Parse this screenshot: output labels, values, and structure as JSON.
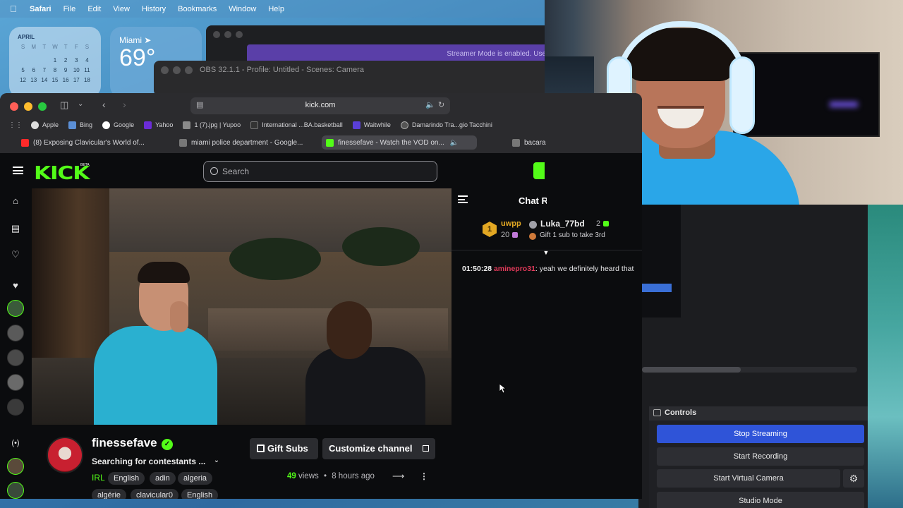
{
  "menubar": {
    "app": "Safari",
    "items": [
      "File",
      "Edit",
      "View",
      "History",
      "Bookmarks",
      "Window",
      "Help"
    ]
  },
  "calendar": {
    "month": "APRIL",
    "weekdays": [
      "S",
      "M",
      "T",
      "W",
      "T",
      "F",
      "S"
    ],
    "days": [
      "",
      "",
      "",
      "",
      "",
      "",
      "",
      "",
      "",
      "",
      "1",
      "2",
      "3",
      "4",
      "5",
      "6",
      "7",
      "8",
      "9",
      "10",
      "11",
      "12",
      "13",
      "14",
      "15",
      "16",
      "17",
      "18"
    ]
  },
  "weather": {
    "city": "Miami",
    "temp": "69°"
  },
  "discord": {
    "banner": "Streamer Mode is enabled. Use"
  },
  "obs": {
    "title": "OBS 32.1.1 - Profile: Untitled - Scenes: Camera",
    "controls_label": "Controls",
    "stop_streaming": "Stop Streaming",
    "start_recording": "Start Recording",
    "start_virtual_camera": "Start Virtual Camera",
    "studio_mode": "Studio Mode"
  },
  "safari": {
    "url": "kick.com",
    "bookmarks": [
      "Apple",
      "Bing",
      "Google",
      "Yahoo",
      "1 (7).jpg | Yupoo",
      "International ...BA.basketball",
      "Waitwhile",
      "Damarindo Tra...gio Tacchini"
    ],
    "tabs": [
      "(8) Exposing Clavicular's World of...",
      "miami police department - Google...",
      "finessefave - Watch the VOD on...",
      "bacara"
    ]
  },
  "kick": {
    "logo": "KICK",
    "beta": "BETA",
    "search_placeholder": "Search",
    "chat_title": "Chat R",
    "leaderboard": {
      "first_rank": "1",
      "first_name": "uwpp",
      "first_count": "20",
      "second_name": "Luka_77bd",
      "second_count": "2",
      "third_text": "Gift 1 sub to take 3rd"
    },
    "message": {
      "time": "01:50:28",
      "user": "aminepro31",
      "text": ": yeah we definitely heard that"
    },
    "channel": {
      "name": "finessefave",
      "title": "Searching for contestants ...",
      "category": "IRL",
      "tags": [
        "English",
        "adin",
        "algeria",
        "algérie",
        "clavicular0",
        "English"
      ],
      "gift_label": "Gift Subs",
      "customize_label": "Customize channel",
      "views_num": "49",
      "views_text": "views",
      "sep": "•",
      "ago": "8 hours ago"
    }
  },
  "colors": {
    "kick_green": "#53fc18",
    "obs_blue": "#2f54d8"
  }
}
